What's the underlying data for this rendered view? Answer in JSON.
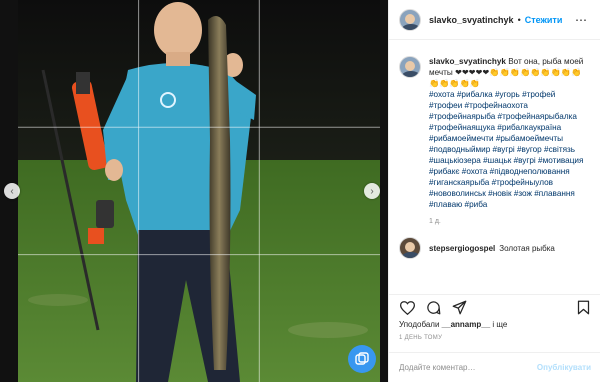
{
  "header": {
    "username": "slavko_svyatinchyk",
    "dot": "•",
    "follow_label": "Стежити",
    "more_icon": "⋯"
  },
  "caption": {
    "username": "slavko_svyatinchyk",
    "text": "Вот она, рыба моей мечты ❤❤❤❤❤👏👏👏👏👏👏👏👏👏👏👏👏👏👏",
    "hashtags": "#охота #рибалка #угорь #трофей #трофеи #трофейнаохота #трофейнаярыба #трофейнаярыбалка #трофейнаящука #рибалкаукраїна #рибамоеймечти #рыбамоеймечты #подводныймир #вугрі #вугор #світязь #шацькіозера #шацьк #вугрі #мотивация #рибакє #охота #підводнеполювання #гиганскаярыба #трофейныулов #нововолинськ #новік #зож #плавання #плаваю #риба",
    "time": "1 д."
  },
  "comment2": {
    "username": "stepsergiogospel",
    "text": "Золотая рыбка"
  },
  "actions": {
    "like_icon": "heart-icon",
    "comment_icon": "comment-icon",
    "share_icon": "share-icon",
    "bookmark_icon": "bookmark-icon"
  },
  "likes": {
    "prefix": "Уподобали",
    "user": "__annamp__",
    "suffix": "і ще"
  },
  "timestamp": "1 ДЕНЬ ТОМУ",
  "add_comment": {
    "placeholder": "Додайте коментар…",
    "publish_label": "Опублікувати"
  },
  "colors": {
    "accent": "#0095f6",
    "wetsuit": "#3aa6c9",
    "grass": "#4d7a2a"
  }
}
